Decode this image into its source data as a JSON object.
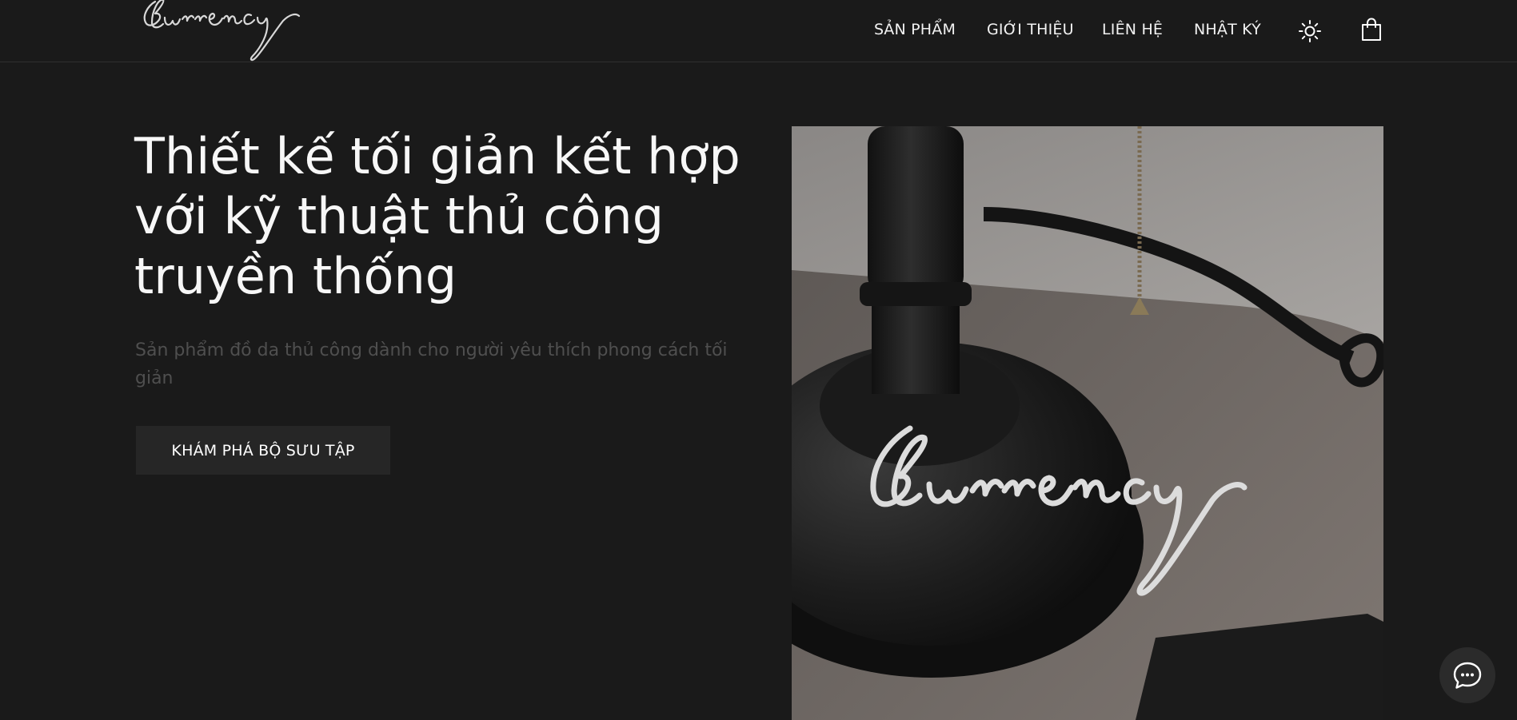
{
  "brand": {
    "name": "currency"
  },
  "nav": {
    "items": [
      {
        "label": "SẢN PHẨM"
      },
      {
        "label": "GIỚI THIỆU"
      },
      {
        "label": "LIÊN HỆ"
      },
      {
        "label": "NHẬT KÝ"
      }
    ],
    "icons": {
      "theme_toggle": "sun-icon",
      "cart": "shopping-bag-icon"
    }
  },
  "hero": {
    "title_lines": [
      "Thiết kế tối giản kết hợp",
      "với kỹ thuật thủ công",
      "truyền thống"
    ],
    "subtitle_lines": [
      "Sản phẩm đồ da thủ công dành cho người yêu thích phong cách tối",
      "giản"
    ],
    "cta_label": "KHÁM PHÁ BỘ SƯU TẬP"
  },
  "chat": {
    "icon": "chat-bubble-icon"
  },
  "colors": {
    "background": "#1a1a1a",
    "text": "#ffffff",
    "subtitle": "#4f4f4f",
    "button_bg": "#262626",
    "divider": "#2f2f2f"
  }
}
